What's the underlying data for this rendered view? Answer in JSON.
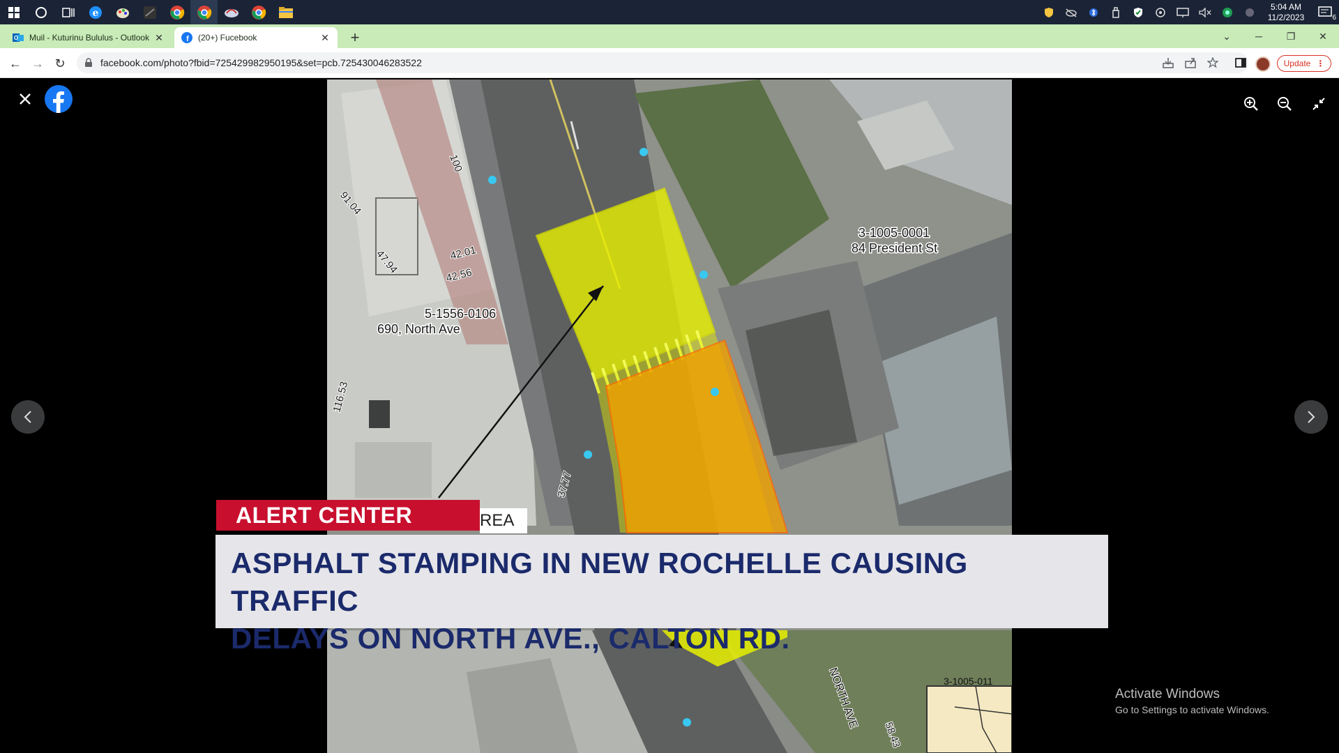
{
  "taskbar": {
    "clock_time": "5:04 AM",
    "clock_date": "11/2/2023",
    "notification_count": "6"
  },
  "browser": {
    "tabs": [
      {
        "label": "Muil - Kuturinu Bululus - Outlook",
        "icon": "outlook-icon"
      },
      {
        "label": "(20+) Fucebook",
        "icon": "facebook-icon"
      }
    ],
    "url": "facebook.com/photo?fbid=725429982950195&set=pcb.725430046283522",
    "update_label": "Update"
  },
  "map": {
    "parcel_left_id": "5-1556-0106",
    "parcel_left_address": "690, North Ave",
    "parcel_right_id": "3-1005-0001",
    "parcel_right_address": "84 President St",
    "street_label": "NORTH AVE",
    "elev_1": "42.01",
    "elev_2": "42.56",
    "elev_3": "91.04",
    "elev_4": "47.94",
    "elev_5": "100",
    "elev_6": "37.77",
    "elev_7": "116.53",
    "elev_8": "58.43",
    "partial_parcel": "3-1005-011"
  },
  "overlay": {
    "tag": "ALERT CENTER",
    "partial_label": "REA",
    "headline_line1": "ASPHALT STAMPING IN NEW ROCHELLE CAUSING TRAFFIC",
    "headline_line2": "DELAYS ON NORTH AVE., CALTON RD."
  },
  "watermark": {
    "title": "Activate Windows",
    "subtitle": "Go to Settings to activate Windows."
  },
  "colors": {
    "alert_red": "#c8102e",
    "headline_blue": "#1b2a6b",
    "tab_bar_green": "#c8ebb8",
    "highlight_yellow": "#e8f000",
    "highlight_orange": "#f0a000"
  }
}
